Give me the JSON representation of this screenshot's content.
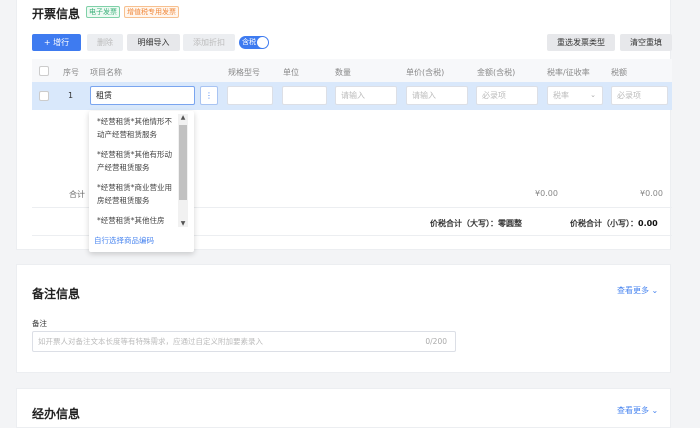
{
  "invoice": {
    "title": "开票信息",
    "tags": [
      "电子发票",
      "增值税专用发票"
    ],
    "toolbar": {
      "add_row": "增行",
      "delete": "删除",
      "import": "明细导入",
      "discount": "添加折扣",
      "tax_toggle": "含税",
      "reselect": "重选发票类型",
      "clear": "清空重填"
    },
    "columns": [
      "序号",
      "项目名称",
      "规格型号",
      "单位",
      "数量",
      "单价(含税)",
      "金额(含税)",
      "税率/征收率",
      "税额"
    ],
    "row": {
      "index": "1",
      "item_name": "租赁",
      "qty_placeholder": "请输入",
      "price_placeholder": "请输入",
      "amount_placeholder": "必录项",
      "tax_rate_placeholder": "税率",
      "tax_placeholder": "必录项"
    },
    "dropdown": {
      "options": [
        "*经营租赁*其他情形不动产经营租赁服务",
        "*经营租赁*其他有形动产经营租赁服务",
        "*经营租赁*商业营业用房经营租赁服务",
        "*经营租赁*其他住房"
      ],
      "footer_link": "自行选择商品编码"
    },
    "total_label": "合计",
    "total_amount": "¥0.00",
    "total_tax": "¥0.00",
    "total_upper_label": "价税合计（大写）：",
    "total_upper_value": "零圆整",
    "total_lower_label": "价税合计（小写）：",
    "total_lower_value": "0.00"
  },
  "remarks": {
    "title": "备注信息",
    "more": "查看更多",
    "field_label": "备注",
    "placeholder": "如开票人对备注文本长度等有特殊需求，应通过自定义附加要素录入",
    "counter": "0/200"
  },
  "handler": {
    "title": "经办信息",
    "more": "查看更多"
  }
}
